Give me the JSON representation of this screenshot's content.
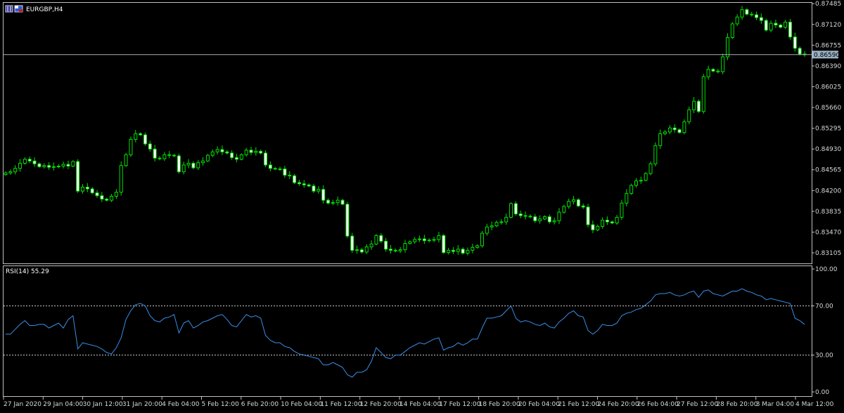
{
  "window": {
    "symbol_title": "EURGBP,H4",
    "current_price_label": "0.86590",
    "icon_1": "window-restore-icon",
    "icon_2": "flag-icon"
  },
  "chart_data": [
    {
      "type": "candlestick",
      "title": "EURGBP,H4",
      "ylim": [
        0.8292,
        0.875
      ],
      "y_ticks": [
        "0.87485",
        "0.87120",
        "0.86755",
        "0.86390",
        "0.86025",
        "0.85660",
        "0.85295",
        "0.84930",
        "0.84565",
        "0.84200",
        "0.83835",
        "0.83470",
        "0.83105"
      ],
      "y_tick_values": [
        0.87485,
        0.8712,
        0.86755,
        0.8639,
        0.86025,
        0.8566,
        0.85295,
        0.8493,
        0.84565,
        0.842,
        0.83835,
        0.8347,
        0.83105
      ],
      "current_price": 0.8659,
      "x_ticks": [
        "27 Jan 2020",
        "29 Jan 04:00",
        "30 Jan 12:00",
        "31 Jan 20:00",
        "4 Feb 04:00",
        "5 Feb 12:00",
        "6 Feb 20:00",
        "10 Feb 04:00",
        "11 Feb 12:00",
        "12 Feb 20:00",
        "14 Feb 04:00",
        "17 Feb 12:00",
        "18 Feb 20:00",
        "20 Feb 04:00",
        "21 Feb 12:00",
        "24 Feb 20:00",
        "26 Feb 04:00",
        "27 Feb 12:00",
        "28 Feb 20:00",
        "3 Mar 04:00",
        "4 Mar 12:00"
      ],
      "close_values": [
        0.8451,
        0.8453,
        0.8459,
        0.8468,
        0.8475,
        0.8472,
        0.8467,
        0.8462,
        0.8464,
        0.8461,
        0.8462,
        0.8463,
        0.8466,
        0.8463,
        0.8471,
        0.8419,
        0.8426,
        0.8423,
        0.8416,
        0.8411,
        0.8405,
        0.8403,
        0.841,
        0.8417,
        0.8464,
        0.8483,
        0.851,
        0.852,
        0.8518,
        0.8502,
        0.8493,
        0.8477,
        0.8476,
        0.8483,
        0.8482,
        0.8481,
        0.8453,
        0.8465,
        0.8468,
        0.846,
        0.8469,
        0.8472,
        0.8482,
        0.8488,
        0.8492,
        0.8488,
        0.8486,
        0.8478,
        0.8475,
        0.8483,
        0.8491,
        0.8487,
        0.8489,
        0.8486,
        0.8465,
        0.8459,
        0.8458,
        0.8458,
        0.8447,
        0.8446,
        0.8434,
        0.8432,
        0.843,
        0.8428,
        0.8419,
        0.8422,
        0.8403,
        0.8398,
        0.8399,
        0.8403,
        0.8396,
        0.834,
        0.8315,
        0.8316,
        0.8312,
        0.8321,
        0.8326,
        0.8341,
        0.8331,
        0.8317,
        0.8315,
        0.8314,
        0.8316,
        0.8327,
        0.833,
        0.8334,
        0.8335,
        0.8332,
        0.8333,
        0.8334,
        0.8341,
        0.8311,
        0.8315,
        0.8313,
        0.8317,
        0.831,
        0.8315,
        0.832,
        0.8323,
        0.8345,
        0.8356,
        0.8358,
        0.8364,
        0.8365,
        0.8373,
        0.8397,
        0.8379,
        0.8376,
        0.8375,
        0.8374,
        0.8367,
        0.837,
        0.8374,
        0.8365,
        0.8367,
        0.8382,
        0.8392,
        0.8401,
        0.8404,
        0.8393,
        0.8391,
        0.836,
        0.8351,
        0.8357,
        0.8368,
        0.8365,
        0.8363,
        0.8373,
        0.8398,
        0.8415,
        0.8429,
        0.8437,
        0.8438,
        0.845,
        0.8467,
        0.8499,
        0.852,
        0.8523,
        0.853,
        0.8527,
        0.8522,
        0.8541,
        0.8562,
        0.8577,
        0.8559,
        0.862,
        0.8633,
        0.863,
        0.8629,
        0.8655,
        0.8689,
        0.8713,
        0.8725,
        0.8738,
        0.873,
        0.8729,
        0.8724,
        0.8719,
        0.8702,
        0.8714,
        0.8711,
        0.8707,
        0.8716,
        0.869,
        0.867,
        0.866,
        0.8659
      ]
    },
    {
      "type": "line",
      "title": "RSI(14) 55.29",
      "ylim": [
        0,
        100
      ],
      "y_ticks": [
        "100.00",
        "70.00",
        "30.00",
        "0.00"
      ],
      "y_tick_values": [
        100,
        70,
        30,
        0
      ],
      "levels": [
        70,
        30
      ],
      "values": [
        47,
        47,
        51,
        55,
        58,
        54,
        54,
        55,
        55,
        52,
        54,
        56,
        52,
        59,
        62,
        35,
        40,
        39,
        38,
        37,
        35,
        32,
        31,
        36,
        44,
        59,
        66,
        71,
        72,
        70,
        62,
        58,
        57,
        60,
        61,
        63,
        48,
        56,
        58,
        52,
        54,
        57,
        58,
        60,
        62,
        63,
        59,
        54,
        53,
        58,
        63,
        61,
        62,
        60,
        46,
        42,
        40,
        40,
        37,
        36,
        33,
        31,
        30,
        29,
        28,
        27,
        22,
        22,
        24,
        22,
        20,
        14,
        12,
        16,
        16,
        18,
        25,
        36,
        32,
        28,
        27,
        30,
        30,
        33,
        36,
        38,
        40,
        39,
        41,
        43,
        44,
        34,
        36,
        37,
        40,
        38,
        40,
        43,
        43,
        52,
        60,
        60,
        61,
        62,
        66,
        70,
        60,
        57,
        58,
        57,
        55,
        54,
        56,
        53,
        52,
        57,
        60,
        64,
        66,
        62,
        61,
        50,
        47,
        50,
        55,
        54,
        54,
        56,
        62,
        64,
        65,
        67,
        68,
        71,
        74,
        79,
        80,
        80,
        81,
        79,
        78,
        79,
        81,
        82,
        77,
        82,
        83,
        80,
        79,
        78,
        80,
        82,
        82,
        84,
        82,
        81,
        79,
        78,
        75,
        76,
        75,
        74,
        73,
        72,
        60,
        58,
        55
      ]
    }
  ]
}
